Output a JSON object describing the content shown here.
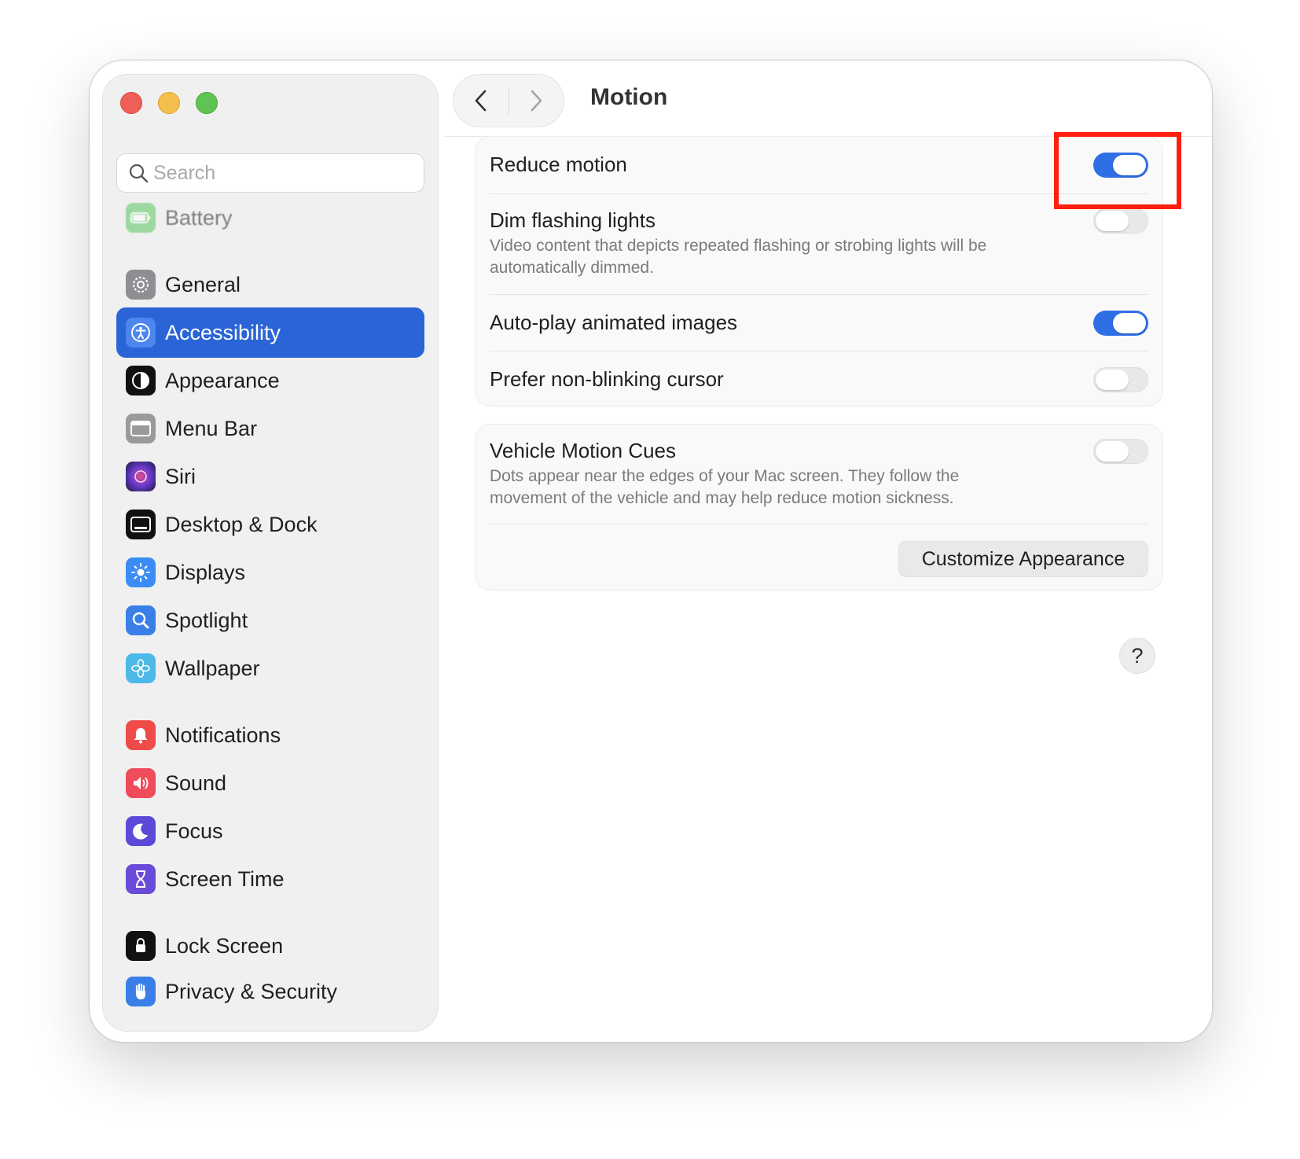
{
  "header": {
    "title": "Motion"
  },
  "search": {
    "placeholder": "Search"
  },
  "sidebar": {
    "items": [
      {
        "label": "Battery",
        "icon": "battery-icon",
        "color": "#5bc65f"
      },
      {
        "label": "General",
        "icon": "gear-icon",
        "color": "#8e8e93"
      },
      {
        "label": "Accessibility",
        "icon": "accessibility-icon",
        "color": "#2a64d6",
        "selected": true
      },
      {
        "label": "Appearance",
        "icon": "appearance-icon",
        "color": "#111111"
      },
      {
        "label": "Menu Bar",
        "icon": "menu-bar-icon",
        "color": "#9a9a9a"
      },
      {
        "label": "Siri",
        "icon": "siri-icon",
        "color": "#5a3bbf"
      },
      {
        "label": "Desktop & Dock",
        "icon": "desktop-dock-icon",
        "color": "#111111"
      },
      {
        "label": "Displays",
        "icon": "displays-icon",
        "color": "#3b8cf5"
      },
      {
        "label": "Spotlight",
        "icon": "spotlight-icon",
        "color": "#3a7fe8"
      },
      {
        "label": "Wallpaper",
        "icon": "wallpaper-icon",
        "color": "#4cb9e8"
      },
      {
        "label": "Notifications",
        "icon": "notifications-icon",
        "color": "#ef4b4b"
      },
      {
        "label": "Sound",
        "icon": "sound-icon",
        "color": "#ef4b5b"
      },
      {
        "label": "Focus",
        "icon": "focus-icon",
        "color": "#5b4ad8"
      },
      {
        "label": "Screen Time",
        "icon": "screen-time-icon",
        "color": "#6a4ad8"
      },
      {
        "label": "Lock Screen",
        "icon": "lock-icon",
        "color": "#111111"
      },
      {
        "label": "Privacy & Security",
        "icon": "privacy-hand-icon",
        "color": "#3a7fe8"
      }
    ]
  },
  "motion": {
    "reduce_motion": {
      "label": "Reduce motion",
      "on": true
    },
    "dim_flashing": {
      "label": "Dim flashing lights",
      "desc_line1": "Video content that depicts repeated flashing or strobing lights will be",
      "desc_line2": "automatically dimmed.",
      "on": false
    },
    "autoplay": {
      "label": "Auto-play animated images",
      "on": true
    },
    "nonblinking": {
      "label": "Prefer non-blinking cursor",
      "on": false
    },
    "vehicle": {
      "label": "Vehicle Motion Cues",
      "desc_line1": "Dots appear near the edges of your Mac screen. They follow the",
      "desc_line2": "movement of the vehicle and may help reduce motion sickness.",
      "on": false
    },
    "customize_button": "Customize Appearance"
  },
  "help": "?",
  "colors": {
    "accent": "#2a64d6",
    "toggle_on": "#2f6fe6",
    "highlight": "#ff1f0f"
  }
}
